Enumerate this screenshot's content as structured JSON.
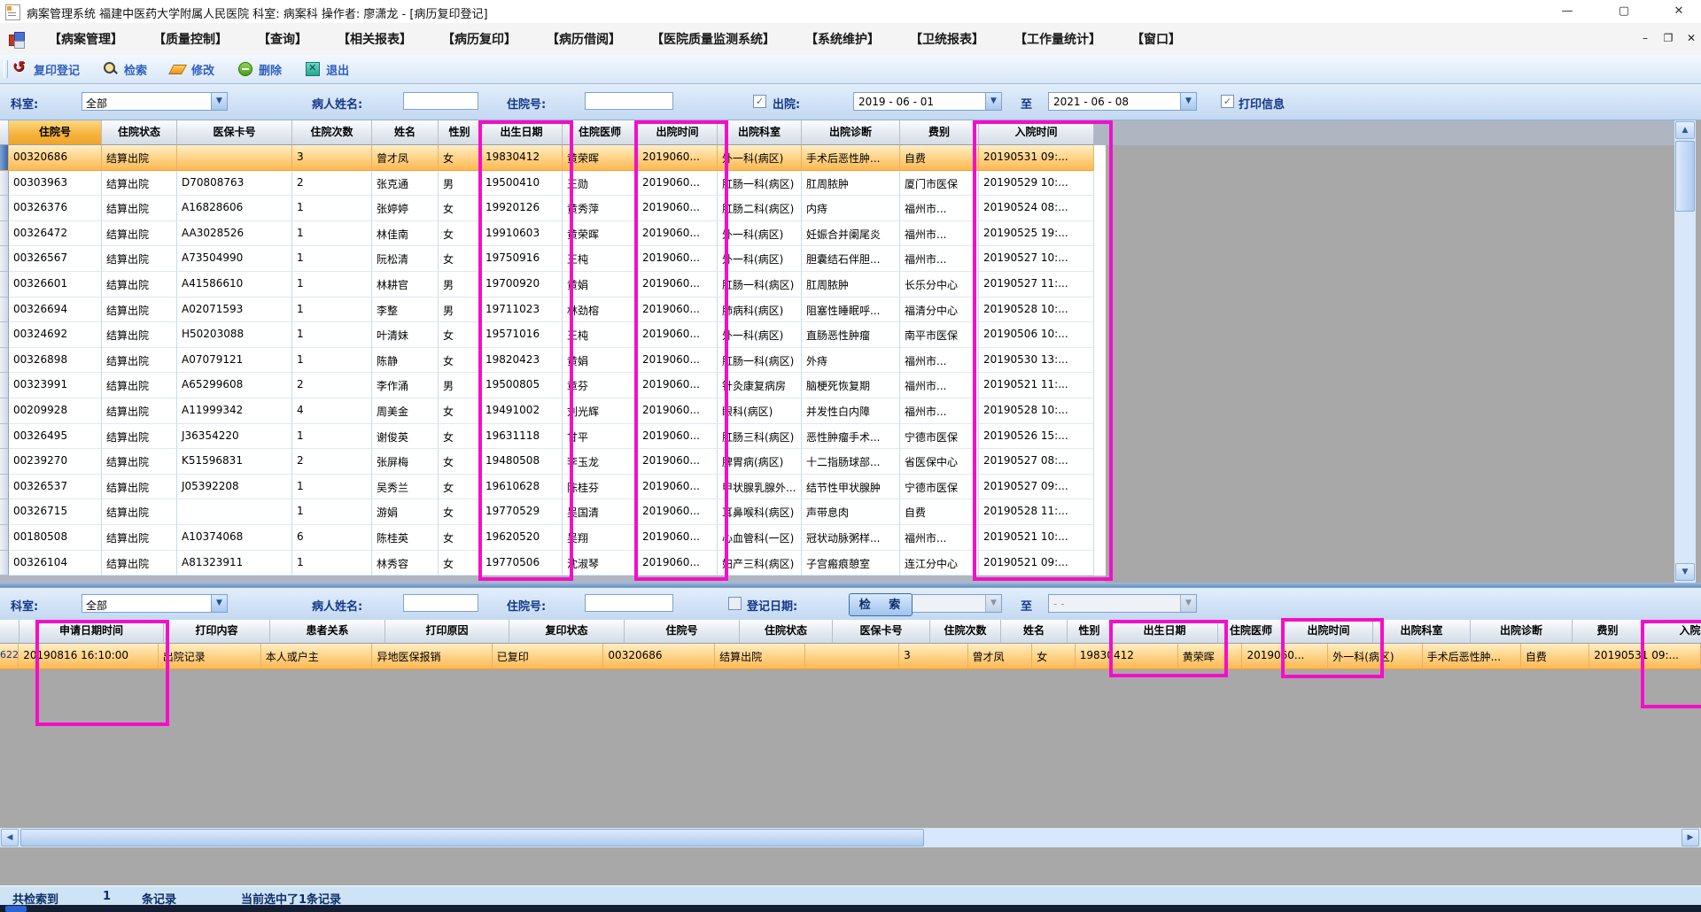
{
  "window": {
    "title": "病案管理系统 福建中医药大学附属人民医院 科室: 病案科 操作者: 廖潇龙 - [病历复印登记]"
  },
  "menu": {
    "items": [
      "【病案管理】",
      "【质量控制】",
      "【查询】",
      "【相关报表】",
      "【病历复印】",
      "【病历借阅】",
      "【医院质量监测系统】",
      "【系统维护】",
      "【卫统报表】",
      "【工作量统计】",
      "【窗口】"
    ]
  },
  "toolbar": {
    "buttons": [
      {
        "name": "copy-register",
        "label": "复印登记"
      },
      {
        "name": "search",
        "label": "检索"
      },
      {
        "name": "modify",
        "label": "修改"
      },
      {
        "name": "delete",
        "label": "删除"
      },
      {
        "name": "exit",
        "label": "退出"
      }
    ]
  },
  "filters": {
    "top": {
      "dept_label": "科室:",
      "dept_value": "全部",
      "name_label": "病人姓名:",
      "name_value": "",
      "admission_label": "住院号:",
      "admission_value": "",
      "discharge_label": "出院:",
      "discharge_checked": true,
      "date_from": "2019 - 06 - 01",
      "to_label": "至",
      "date_to": "2021 - 06 - 08",
      "print_info_label": "打印信息",
      "print_info_checked": true
    },
    "bottom": {
      "dept_label": "科室:",
      "dept_value": "全部",
      "name_label": "病人姓名:",
      "name_value": "",
      "admission_label": "住院号:",
      "admission_value": "",
      "register_date_label": "登记日期:",
      "register_checked": false,
      "date_from_placeholder": "-      -",
      "to_label": "至",
      "date_to_placeholder": "-      -",
      "search_button": "检 索"
    }
  },
  "table_top": {
    "columns": [
      "住院号",
      "住院状态",
      "医保卡号",
      "住院次数",
      "姓名",
      "性别",
      "出生日期",
      "住院医师",
      "出院时间",
      "出院科室",
      "出院诊断",
      "费别",
      "入院时间"
    ],
    "rows": [
      [
        "00320686",
        "结算出院",
        "",
        "3",
        "曾才凤",
        "女",
        "19830412",
        "黄荣晖",
        "2019060...",
        "外一科(病区)",
        "手术后恶性肿...",
        "自费",
        "20190531 09:..."
      ],
      [
        "00303963",
        "结算出院",
        "D70808763",
        "2",
        "张克通",
        "男",
        "19500410",
        "王勋",
        "2019060...",
        "肛肠一科(病区)",
        "肛周脓肿",
        "厦门市医保",
        "20190529 10:..."
      ],
      [
        "00326376",
        "结算出院",
        "A16828606",
        "1",
        "张婷婷",
        "女",
        "19920126",
        "黄秀萍",
        "2019060...",
        "肛肠二科(病区)",
        "内痔",
        "福州市...",
        "20190524 08:..."
      ],
      [
        "00326472",
        "结算出院",
        "AA3028526",
        "1",
        "林佳南",
        "女",
        "19910603",
        "黄荣晖",
        "2019060...",
        "外一科(病区)",
        "妊娠合并阑尾炎",
        "福州市...",
        "20190525 19:..."
      ],
      [
        "00326567",
        "结算出院",
        "A73504990",
        "1",
        "阮松清",
        "女",
        "19750916",
        "王杶",
        "2019060...",
        "外一科(病区)",
        "胆囊结石伴胆...",
        "福州市...",
        "20190527 10:..."
      ],
      [
        "00326601",
        "结算出院",
        "A41586610",
        "1",
        "林耕官",
        "男",
        "19700920",
        "黄娟",
        "2019060...",
        "肛肠一科(病区)",
        "肛周脓肿",
        "长乐分中心",
        "20190527 11:..."
      ],
      [
        "00326694",
        "结算出院",
        "A02071593",
        "1",
        "李整",
        "男",
        "19711023",
        "林劲榕",
        "2019060...",
        "肺病科(病区)",
        "阻塞性睡眠呼...",
        "福清分中心",
        "20190528 10:..."
      ],
      [
        "00324692",
        "结算出院",
        "H50203088",
        "1",
        "叶清妹",
        "女",
        "19571016",
        "王杶",
        "2019060...",
        "外一科(病区)",
        "直肠恶性肿瘤",
        "南平市医保",
        "20190506 10:..."
      ],
      [
        "00326898",
        "结算出院",
        "A07079121",
        "1",
        "陈静",
        "女",
        "19820423",
        "黄娟",
        "2019060...",
        "肛肠一科(病区)",
        "外痔",
        "福州市...",
        "20190530 13:..."
      ],
      [
        "00323991",
        "结算出院",
        "A65299608",
        "2",
        "李作涌",
        "男",
        "19500805",
        "章芬",
        "2019060...",
        "针灸康复病房",
        "脑梗死恢复期",
        "福州市...",
        "20190521 11:..."
      ],
      [
        "00209928",
        "结算出院",
        "A11999342",
        "4",
        "周美金",
        "女",
        "19491002",
        "刘光辉",
        "2019060...",
        "眼科(病区)",
        "并发性白内障",
        "福州市...",
        "20190528 10:..."
      ],
      [
        "00326495",
        "结算出院",
        "J36354220",
        "1",
        "谢俊英",
        "女",
        "19631118",
        "甘平",
        "2019060...",
        "肛肠三科(病区)",
        "恶性肿瘤手术...",
        "宁德市医保",
        "20190526 15:..."
      ],
      [
        "00239270",
        "结算出院",
        "K51596831",
        "2",
        "张屏梅",
        "女",
        "19480508",
        "李玉龙",
        "2019060...",
        "脾胃病(病区)",
        "十二指肠球部...",
        "省医保中心",
        "20190527 08:..."
      ],
      [
        "00326537",
        "结算出院",
        "J05392208",
        "1",
        "吴秀兰",
        "女",
        "19610628",
        "陈桂芬",
        "2019060...",
        "甲状腺乳腺外...",
        "结节性甲状腺肿",
        "宁德市医保",
        "20190527 09:..."
      ],
      [
        "00326715",
        "结算出院",
        "",
        "1",
        "游娟",
        "女",
        "19770529",
        "吴国清",
        "2019060...",
        "耳鼻喉科(病区)",
        "声带息肉",
        "自费",
        "20190528 11:..."
      ],
      [
        "00180508",
        "结算出院",
        "A10374068",
        "6",
        "陈桂英",
        "女",
        "19620520",
        "吴翔",
        "2019060...",
        "心血管科(一区)",
        "冠状动脉粥样...",
        "福州市...",
        "20190521 10:..."
      ],
      [
        "00326104",
        "结算出院",
        "A81323911",
        "1",
        "林秀容",
        "女",
        "19770506",
        "沈淑琴",
        "2019060...",
        "妇产三科(病区)",
        "子宫瘢痕憩室",
        "连江分中心",
        "20190521 09:..."
      ]
    ],
    "selected_row_index": 0
  },
  "table_bottom": {
    "columns": [
      "申请日期时间",
      "打印内容",
      "患者关系",
      "打印原因",
      "复印状态",
      "住院号",
      "住院状态",
      "医保卡号",
      "住院次数",
      "姓名",
      "性别",
      "出生日期",
      "住院医师",
      "出院时间",
      "出院科室",
      "出院诊断",
      "费别",
      "入院时间"
    ],
    "row_header": "622",
    "row": [
      "20190816 16:10:00",
      "出院记录",
      "本人或户主",
      "异地医保报销",
      "已复印",
      "00320686",
      "结算出院",
      "",
      "3",
      "曾才凤",
      "女",
      "19830412",
      "黄荣晖",
      "2019060...",
      "外一科(病区)",
      "手术后恶性肿...",
      "自费",
      "20190531 09:..."
    ]
  },
  "statusbar": {
    "found_label": "共检索到",
    "count": "1",
    "records_label": "条记录",
    "selection": "当前选中了1条记录"
  },
  "colors": {
    "highlight": "#f40ec8",
    "selection_orange": "#ffb852",
    "sorted_header": "#f5b23c"
  }
}
